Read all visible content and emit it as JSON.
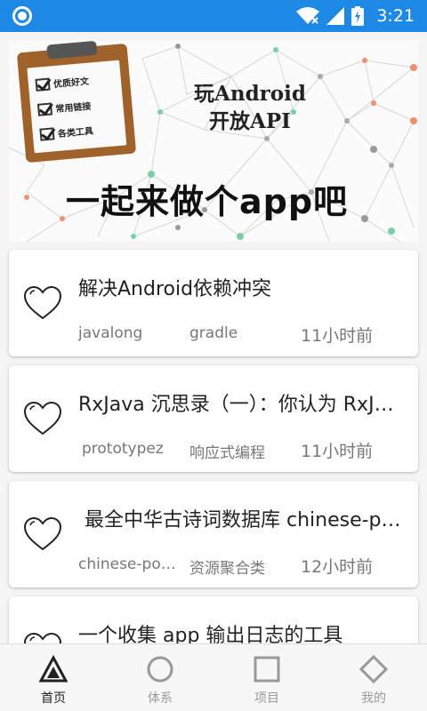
{
  "status_bar": {
    "time": "3:21",
    "color": "#1e88e5"
  },
  "banner": {
    "clipboard_items": [
      "优质好文",
      "常用链接",
      "各类工具"
    ],
    "title_line1": "玩Android",
    "title_line2": "开放API",
    "slogan": "一起来做个app吧"
  },
  "articles": [
    {
      "title": "解决Android依赖冲突",
      "author": "javalong",
      "chapter": "gradle",
      "time": "11小时前",
      "icon": "heart-outline-icon"
    },
    {
      "title": "RxJava 沉思录（一）：你认为 RxJava 真的好用吗？",
      "author": "prototypez",
      "chapter": "响应式编程",
      "time": "11小时前",
      "icon": "heart-outline-icon"
    },
    {
      "title": " 最全中华古诗词数据库 chinese-poetry",
      "author": "chinese-poetry",
      "chapter": "资源聚合类",
      "time": "12小时前",
      "icon": "heart-outline-icon"
    },
    {
      "title": "一个收集 app 输出日志的工具",
      "author": "",
      "chapter": "",
      "time": "",
      "icon": "heart-outline-icon"
    }
  ],
  "bottom_nav": [
    {
      "label": "首页",
      "icon": "triangle-icon",
      "active": true
    },
    {
      "label": "体系",
      "icon": "circle-icon",
      "active": false
    },
    {
      "label": "项目",
      "icon": "square-icon",
      "active": false
    },
    {
      "label": "我的",
      "icon": "diamond-icon",
      "active": false
    }
  ]
}
